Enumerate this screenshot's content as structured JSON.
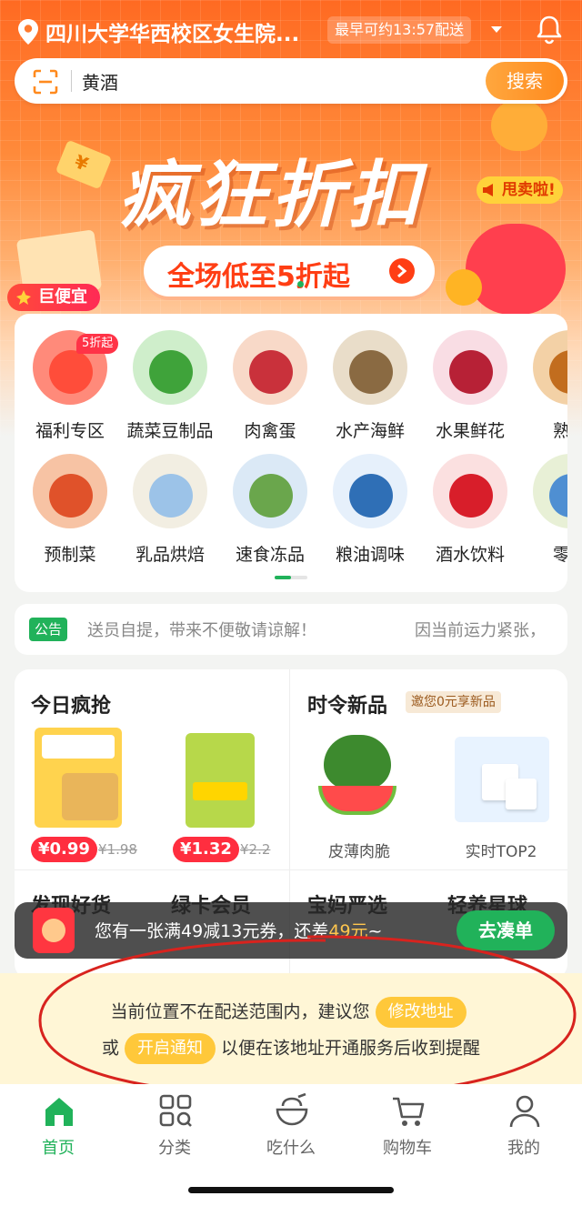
{
  "header": {
    "location": "四川大学华西校区女生院...",
    "eta": "最早可约13:57配送"
  },
  "search": {
    "value": "黄酒",
    "button_label": "搜索"
  },
  "banner": {
    "title": "疯狂折扣",
    "badge": "甩卖啦!",
    "pill": "全场低至5折起",
    "corner_label": "巨便宜"
  },
  "categories": [
    {
      "label": "福利专区",
      "tag": "5折起"
    },
    {
      "label": "蔬菜豆制品"
    },
    {
      "label": "肉禽蛋"
    },
    {
      "label": "水产海鲜"
    },
    {
      "label": "水果鲜花"
    },
    {
      "label": "熟食"
    },
    {
      "label": "预制菜"
    },
    {
      "label": "乳品烘焙"
    },
    {
      "label": "速食冻品"
    },
    {
      "label": "粮油调味"
    },
    {
      "label": "酒水饮料"
    },
    {
      "label": "零食"
    }
  ],
  "notice": {
    "tag": "公告",
    "text": "送员自提，带来不便敬请谅解！",
    "text2": "因当前运力紧张，"
  },
  "promo": {
    "left_title": "今日疯抢",
    "right_title": "时令新品",
    "right_chip": "邀您0元享新品",
    "products_left": [
      {
        "price": "¥0.99",
        "original": "¥1.98"
      },
      {
        "price": "¥1.32",
        "original": "¥2.2"
      }
    ],
    "products_right": [
      {
        "caption": "皮薄肉脆"
      },
      {
        "caption": "实时TOP2"
      }
    ],
    "lower_titles": [
      "发现好货",
      "绿卡会员",
      "宝妈严选",
      "轻养星球"
    ]
  },
  "coupon": {
    "text_before": "您有一张满49减13元券，还差",
    "amount": "49元",
    "text_after": "~",
    "button_label": "去凑单"
  },
  "address_notice": {
    "line1": "当前位置不在配送范围内，建议您",
    "modify_label": "修改地址",
    "line2_prefix": "或",
    "notify_label": "开启通知",
    "line2_suffix": "以便在该地址开通服务后收到提醒"
  },
  "tabs": [
    {
      "label": "首页",
      "icon": "home-icon",
      "active": true
    },
    {
      "label": "分类",
      "icon": "category-grid-icon"
    },
    {
      "label": "吃什么",
      "icon": "bowl-icon"
    },
    {
      "label": "购物车",
      "icon": "cart-icon"
    },
    {
      "label": "我的",
      "icon": "profile-icon"
    }
  ],
  "colors": {
    "brand_green": "#21b25a",
    "banner_orange": "#ff6a22",
    "price_red": "#ff2e3f",
    "address_yellow": "#ffc83a"
  }
}
